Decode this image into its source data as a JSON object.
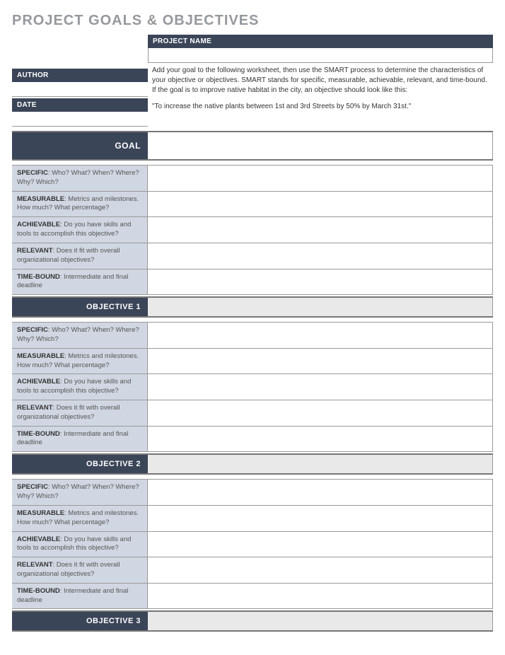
{
  "title": "PROJECT GOALS & OBJECTIVES",
  "header": {
    "project_name_label": "PROJECT NAME",
    "project_name_value": "",
    "author_label": "AUTHOR",
    "author_value": "",
    "date_label": "DATE",
    "date_value": ""
  },
  "instruction_text": "Add your goal to the following worksheet, then use the SMART process to determine the characteristics of your objective or objectives. SMART stands for specific, measurable, achievable, relevant, and time-bound. If the goal is to improve native habitat in the city, an objective should look like this:",
  "instruction_quote": "\"To increase the native plants between 1st and 3rd Streets by 50% by March 31st.\"",
  "goal": {
    "label": "GOAL",
    "value": ""
  },
  "smart": {
    "specific": {
      "key": "SPECIFIC",
      "hint": ": Who? What? When? Where? Why? Which?"
    },
    "measurable": {
      "key": "MEASURABLE",
      "hint": ": Metrics and milestones. How much? What percentage?"
    },
    "achievable": {
      "key": "ACHIEVABLE",
      "hint": ": Do you have skills and tools to accomplish this objective?"
    },
    "relevant": {
      "key": "RELEVANT",
      "hint": ": Does it fit with overall organizational objectives?"
    },
    "timebound": {
      "key": "TIME-BOUND",
      "hint": ": Intermediate and final deadline"
    }
  },
  "objectives": [
    {
      "label": "OBJECTIVE 1",
      "value": ""
    },
    {
      "label": "OBJECTIVE 2",
      "value": ""
    },
    {
      "label": "OBJECTIVE 3",
      "value": ""
    }
  ]
}
